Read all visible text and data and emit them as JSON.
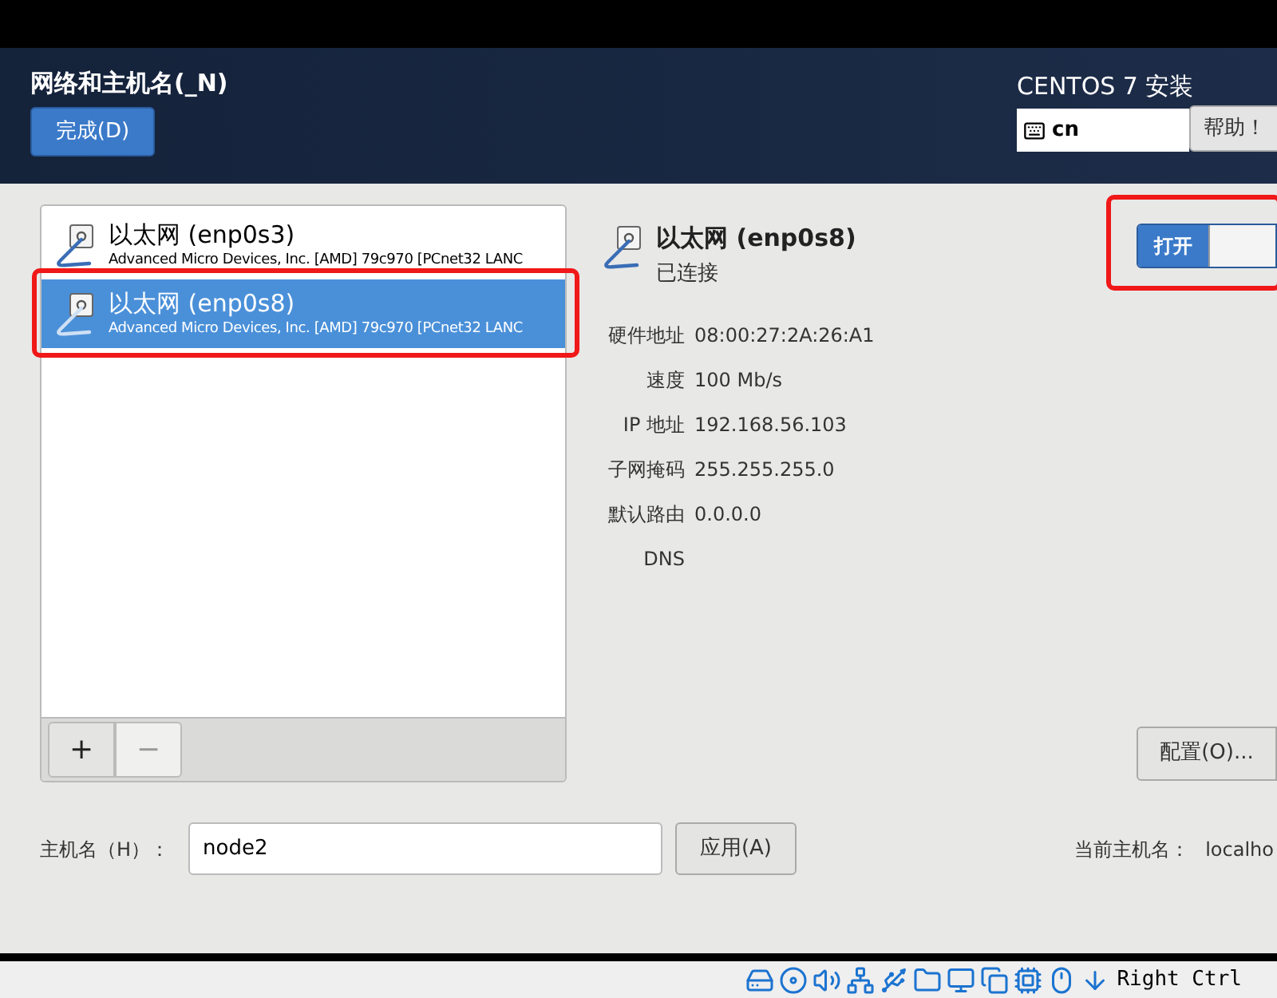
{
  "header": {
    "title": "网络和主机名(_N)",
    "done_button": "完成(D)",
    "product": "CENTOS 7 安装",
    "keyboard": "cn",
    "help_button": "帮助！"
  },
  "devices": [
    {
      "name": "以太网 (enp0s3)",
      "description": "Advanced Micro Devices, Inc. [AMD] 79c970 [PCnet32 LANC",
      "selected": false,
      "annotated": false
    },
    {
      "name": "以太网 (enp0s8)",
      "description": "Advanced Micro Devices, Inc. [AMD] 79c970 [PCnet32 LANC",
      "selected": true,
      "annotated": true
    }
  ],
  "list_toolbar": [
    "+",
    "−"
  ],
  "detail": {
    "name": "以太网 (enp0s8)",
    "status": "已连接",
    "switch": {
      "label": "打开",
      "on": true,
      "annotated": true
    },
    "fields": [
      {
        "label": "硬件地址",
        "value": "08:00:27:2A:26:A1"
      },
      {
        "label": "速度",
        "value": "100 Mb/s"
      },
      {
        "label": "IP 地址",
        "value": "192.168.56.103"
      },
      {
        "label": "子网掩码",
        "value": "255.255.255.0"
      },
      {
        "label": "默认路由",
        "value": "0.0.0.0"
      },
      {
        "label": "DNS"
      }
    ],
    "config_button": "配置(O)..."
  },
  "hostname": {
    "label": "主机名（H）：",
    "value": "node2",
    "apply_button": "应用(A)",
    "current_label": "当前主机名：",
    "current_value": "localho"
  },
  "status_bar": {
    "host_key": "Right Ctrl"
  }
}
